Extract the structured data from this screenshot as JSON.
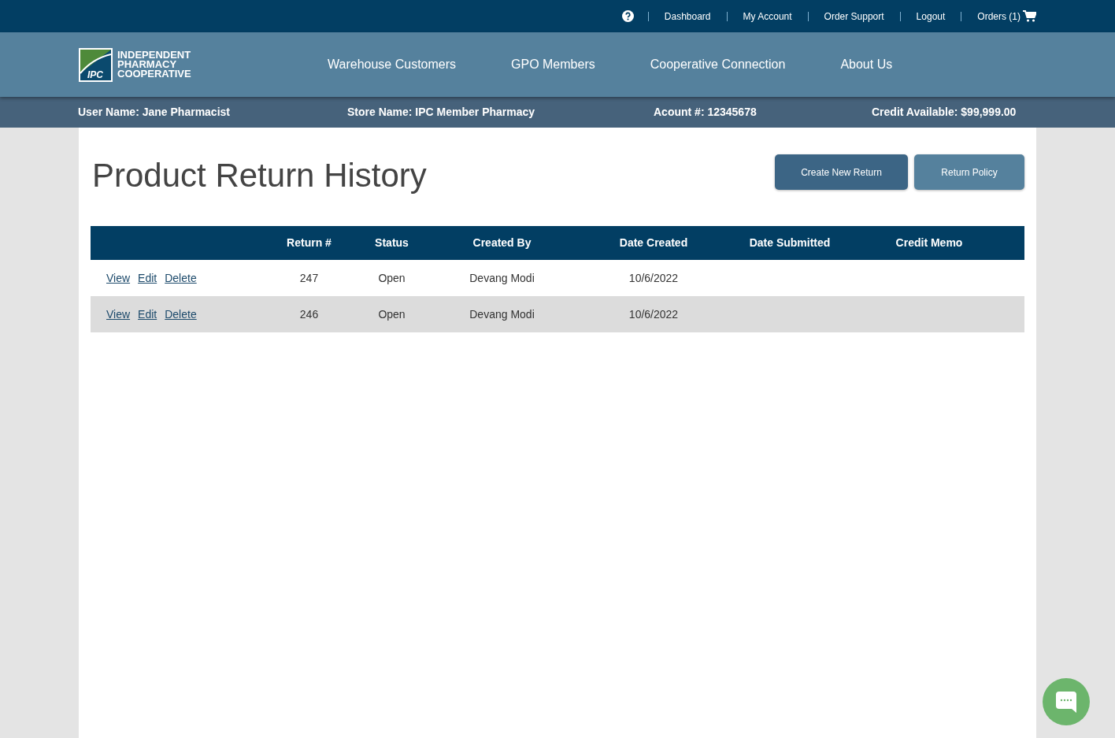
{
  "top_links": [
    "Dashboard",
    "My Account",
    "Order Support",
    "Logout",
    "Orders (1)"
  ],
  "logo": {
    "badge": "IPC",
    "lines": [
      "INDEPENDENT",
      "PHARMACY",
      "COOPERATIVE"
    ]
  },
  "nav": [
    "Warehouse Customers",
    "GPO Members",
    "Cooperative Connection",
    "About Us"
  ],
  "info_bar": [
    "User Name: Jane Pharmacist",
    "Store Name: IPC Member Pharmacy",
    "Acount #: 12345678",
    "Credit Available: $99,999.00"
  ],
  "page_title": "Product Return History",
  "buttons": [
    {
      "label": "Create New Return",
      "selected": true
    },
    {
      "label": "Return Policy",
      "selected": false
    }
  ],
  "table": {
    "columns": [
      "",
      "Return #",
      "Status",
      "Created By",
      "Date Created",
      "Date Submitted",
      "Credit Memo"
    ],
    "rows": [
      {
        "cells": [
          {
            "links": [
              "View",
              "Edit",
              "Delete"
            ]
          },
          "247",
          "Open",
          "Devang Modi",
          "10/6/2022",
          "",
          ""
        ]
      },
      {
        "cells": [
          {
            "links": [
              "View",
              "Edit",
              "Delete"
            ]
          },
          "246",
          "Open",
          "Devang Modi",
          "10/6/2022",
          "",
          ""
        ]
      }
    ]
  }
}
